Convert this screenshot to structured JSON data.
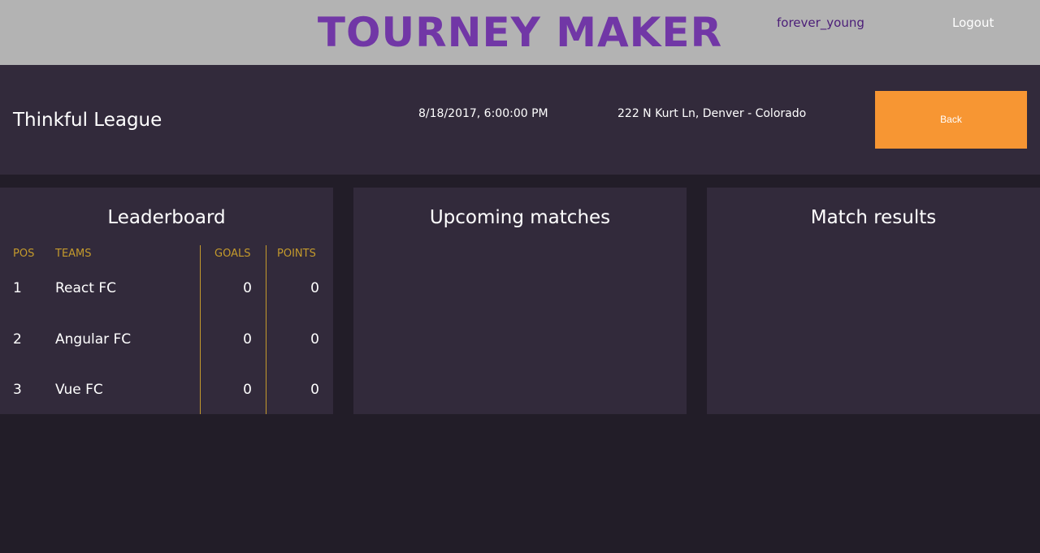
{
  "header": {
    "app_title": "TOURNEY MAKER",
    "username": "forever_young",
    "logout_label": "Logout"
  },
  "league": {
    "name": "Thinkful League",
    "datetime": "8/18/2017, 6:00:00 PM",
    "location": "222 N Kurt Ln, Denver - Colorado",
    "back_label": "Back"
  },
  "leaderboard": {
    "title": "Leaderboard",
    "columns": {
      "pos": "POS",
      "teams": "TEAMS",
      "goals": "GOALS",
      "points": "POINTS"
    },
    "rows": [
      {
        "pos": "1",
        "team": "React FC",
        "goals": "0",
        "points": "0"
      },
      {
        "pos": "2",
        "team": "Angular FC",
        "goals": "0",
        "points": "0"
      },
      {
        "pos": "3",
        "team": "Vue FC",
        "goals": "0",
        "points": "0"
      }
    ]
  },
  "upcoming": {
    "title": "Upcoming matches"
  },
  "results": {
    "title": "Match results"
  },
  "colors": {
    "topbar_bg": "#b3b3b3",
    "brand_purple": "#7137a6",
    "panel_bg": "#322a3b",
    "page_bg": "#221d28",
    "accent_orange": "#f79633",
    "header_gold": "#c49a2c"
  }
}
